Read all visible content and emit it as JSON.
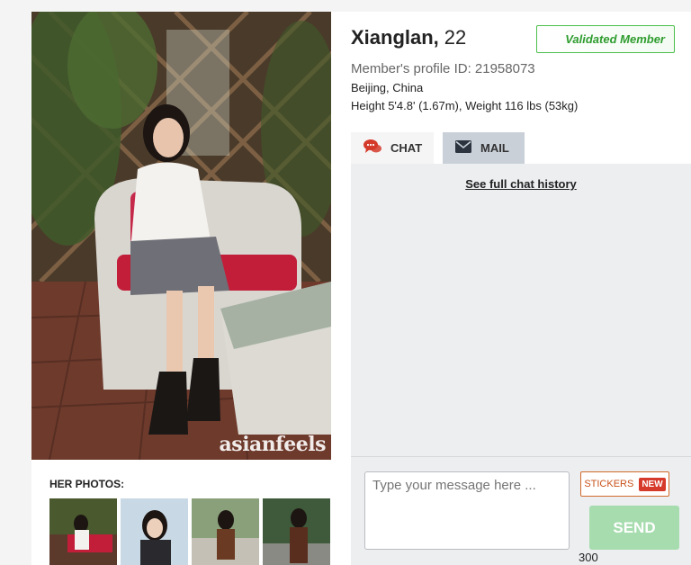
{
  "profile": {
    "name": "Xianglan,",
    "age": "22",
    "badge": "Validated Member",
    "profile_id": "Member's profile ID: 21958073",
    "location": "Beijing, China",
    "measurements": "Height 5'4.8' (1.67m), Weight 116 lbs (53kg)"
  },
  "photo": {
    "watermark": "asianfeels",
    "gallery_label": "HER PHOTOS:",
    "thumbnail_count": 4
  },
  "tabs": [
    {
      "label": "CHAT",
      "icon": "chat-bubbles-icon",
      "active": true
    },
    {
      "label": "MAIL",
      "icon": "envelope-icon",
      "active": false
    }
  ],
  "chat": {
    "history_link": "See full chat history",
    "placeholder": "Type your message here ...",
    "stickers_label": "STICKERS",
    "new_badge": "NEW",
    "send_label": "SEND",
    "char_limit": "300"
  },
  "colors": {
    "validated_green": "#2e9c2e",
    "send_button": "#a6dcae",
    "stickers_orange": "#c9521a",
    "new_badge_red": "#d63a2a",
    "chat_icon_red": "#d43a2a"
  }
}
